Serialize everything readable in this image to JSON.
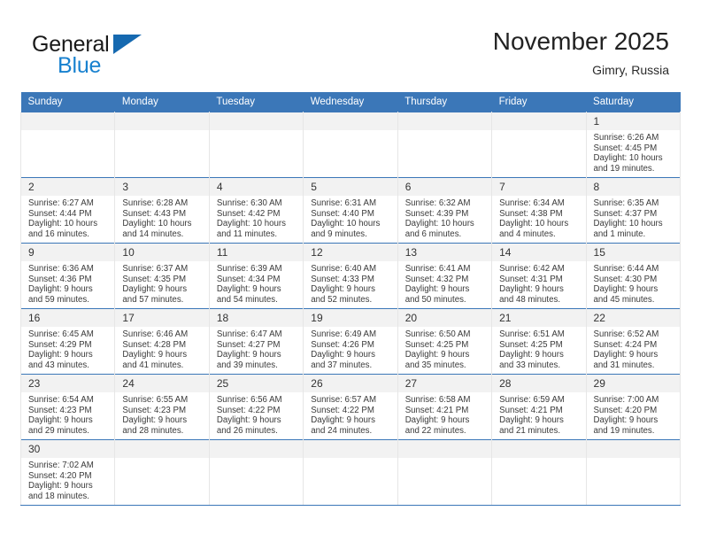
{
  "brand": {
    "name_part1": "General",
    "name_part2": "Blue",
    "accent_color": "#1881cf",
    "triangle_color": "#1569b0"
  },
  "header": {
    "title": "November 2025",
    "location": "Gimry, Russia"
  },
  "calendar": {
    "header_bg": "#3b77b8",
    "weekdays": [
      "Sunday",
      "Monday",
      "Tuesday",
      "Wednesday",
      "Thursday",
      "Friday",
      "Saturday"
    ],
    "weeks": [
      [
        {
          "day": "",
          "sunrise": "",
          "sunset": "",
          "daylight1": "",
          "daylight2": ""
        },
        {
          "day": "",
          "sunrise": "",
          "sunset": "",
          "daylight1": "",
          "daylight2": ""
        },
        {
          "day": "",
          "sunrise": "",
          "sunset": "",
          "daylight1": "",
          "daylight2": ""
        },
        {
          "day": "",
          "sunrise": "",
          "sunset": "",
          "daylight1": "",
          "daylight2": ""
        },
        {
          "day": "",
          "sunrise": "",
          "sunset": "",
          "daylight1": "",
          "daylight2": ""
        },
        {
          "day": "",
          "sunrise": "",
          "sunset": "",
          "daylight1": "",
          "daylight2": ""
        },
        {
          "day": "1",
          "sunrise": "Sunrise: 6:26 AM",
          "sunset": "Sunset: 4:45 PM",
          "daylight1": "Daylight: 10 hours",
          "daylight2": "and 19 minutes."
        }
      ],
      [
        {
          "day": "2",
          "sunrise": "Sunrise: 6:27 AM",
          "sunset": "Sunset: 4:44 PM",
          "daylight1": "Daylight: 10 hours",
          "daylight2": "and 16 minutes."
        },
        {
          "day": "3",
          "sunrise": "Sunrise: 6:28 AM",
          "sunset": "Sunset: 4:43 PM",
          "daylight1": "Daylight: 10 hours",
          "daylight2": "and 14 minutes."
        },
        {
          "day": "4",
          "sunrise": "Sunrise: 6:30 AM",
          "sunset": "Sunset: 4:42 PM",
          "daylight1": "Daylight: 10 hours",
          "daylight2": "and 11 minutes."
        },
        {
          "day": "5",
          "sunrise": "Sunrise: 6:31 AM",
          "sunset": "Sunset: 4:40 PM",
          "daylight1": "Daylight: 10 hours",
          "daylight2": "and 9 minutes."
        },
        {
          "day": "6",
          "sunrise": "Sunrise: 6:32 AM",
          "sunset": "Sunset: 4:39 PM",
          "daylight1": "Daylight: 10 hours",
          "daylight2": "and 6 minutes."
        },
        {
          "day": "7",
          "sunrise": "Sunrise: 6:34 AM",
          "sunset": "Sunset: 4:38 PM",
          "daylight1": "Daylight: 10 hours",
          "daylight2": "and 4 minutes."
        },
        {
          "day": "8",
          "sunrise": "Sunrise: 6:35 AM",
          "sunset": "Sunset: 4:37 PM",
          "daylight1": "Daylight: 10 hours",
          "daylight2": "and 1 minute."
        }
      ],
      [
        {
          "day": "9",
          "sunrise": "Sunrise: 6:36 AM",
          "sunset": "Sunset: 4:36 PM",
          "daylight1": "Daylight: 9 hours",
          "daylight2": "and 59 minutes."
        },
        {
          "day": "10",
          "sunrise": "Sunrise: 6:37 AM",
          "sunset": "Sunset: 4:35 PM",
          "daylight1": "Daylight: 9 hours",
          "daylight2": "and 57 minutes."
        },
        {
          "day": "11",
          "sunrise": "Sunrise: 6:39 AM",
          "sunset": "Sunset: 4:34 PM",
          "daylight1": "Daylight: 9 hours",
          "daylight2": "and 54 minutes."
        },
        {
          "day": "12",
          "sunrise": "Sunrise: 6:40 AM",
          "sunset": "Sunset: 4:33 PM",
          "daylight1": "Daylight: 9 hours",
          "daylight2": "and 52 minutes."
        },
        {
          "day": "13",
          "sunrise": "Sunrise: 6:41 AM",
          "sunset": "Sunset: 4:32 PM",
          "daylight1": "Daylight: 9 hours",
          "daylight2": "and 50 minutes."
        },
        {
          "day": "14",
          "sunrise": "Sunrise: 6:42 AM",
          "sunset": "Sunset: 4:31 PM",
          "daylight1": "Daylight: 9 hours",
          "daylight2": "and 48 minutes."
        },
        {
          "day": "15",
          "sunrise": "Sunrise: 6:44 AM",
          "sunset": "Sunset: 4:30 PM",
          "daylight1": "Daylight: 9 hours",
          "daylight2": "and 45 minutes."
        }
      ],
      [
        {
          "day": "16",
          "sunrise": "Sunrise: 6:45 AM",
          "sunset": "Sunset: 4:29 PM",
          "daylight1": "Daylight: 9 hours",
          "daylight2": "and 43 minutes."
        },
        {
          "day": "17",
          "sunrise": "Sunrise: 6:46 AM",
          "sunset": "Sunset: 4:28 PM",
          "daylight1": "Daylight: 9 hours",
          "daylight2": "and 41 minutes."
        },
        {
          "day": "18",
          "sunrise": "Sunrise: 6:47 AM",
          "sunset": "Sunset: 4:27 PM",
          "daylight1": "Daylight: 9 hours",
          "daylight2": "and 39 minutes."
        },
        {
          "day": "19",
          "sunrise": "Sunrise: 6:49 AM",
          "sunset": "Sunset: 4:26 PM",
          "daylight1": "Daylight: 9 hours",
          "daylight2": "and 37 minutes."
        },
        {
          "day": "20",
          "sunrise": "Sunrise: 6:50 AM",
          "sunset": "Sunset: 4:25 PM",
          "daylight1": "Daylight: 9 hours",
          "daylight2": "and 35 minutes."
        },
        {
          "day": "21",
          "sunrise": "Sunrise: 6:51 AM",
          "sunset": "Sunset: 4:25 PM",
          "daylight1": "Daylight: 9 hours",
          "daylight2": "and 33 minutes."
        },
        {
          "day": "22",
          "sunrise": "Sunrise: 6:52 AM",
          "sunset": "Sunset: 4:24 PM",
          "daylight1": "Daylight: 9 hours",
          "daylight2": "and 31 minutes."
        }
      ],
      [
        {
          "day": "23",
          "sunrise": "Sunrise: 6:54 AM",
          "sunset": "Sunset: 4:23 PM",
          "daylight1": "Daylight: 9 hours",
          "daylight2": "and 29 minutes."
        },
        {
          "day": "24",
          "sunrise": "Sunrise: 6:55 AM",
          "sunset": "Sunset: 4:23 PM",
          "daylight1": "Daylight: 9 hours",
          "daylight2": "and 28 minutes."
        },
        {
          "day": "25",
          "sunrise": "Sunrise: 6:56 AM",
          "sunset": "Sunset: 4:22 PM",
          "daylight1": "Daylight: 9 hours",
          "daylight2": "and 26 minutes."
        },
        {
          "day": "26",
          "sunrise": "Sunrise: 6:57 AM",
          "sunset": "Sunset: 4:22 PM",
          "daylight1": "Daylight: 9 hours",
          "daylight2": "and 24 minutes."
        },
        {
          "day": "27",
          "sunrise": "Sunrise: 6:58 AM",
          "sunset": "Sunset: 4:21 PM",
          "daylight1": "Daylight: 9 hours",
          "daylight2": "and 22 minutes."
        },
        {
          "day": "28",
          "sunrise": "Sunrise: 6:59 AM",
          "sunset": "Sunset: 4:21 PM",
          "daylight1": "Daylight: 9 hours",
          "daylight2": "and 21 minutes."
        },
        {
          "day": "29",
          "sunrise": "Sunrise: 7:00 AM",
          "sunset": "Sunset: 4:20 PM",
          "daylight1": "Daylight: 9 hours",
          "daylight2": "and 19 minutes."
        }
      ],
      [
        {
          "day": "30",
          "sunrise": "Sunrise: 7:02 AM",
          "sunset": "Sunset: 4:20 PM",
          "daylight1": "Daylight: 9 hours",
          "daylight2": "and 18 minutes."
        },
        {
          "day": "",
          "sunrise": "",
          "sunset": "",
          "daylight1": "",
          "daylight2": ""
        },
        {
          "day": "",
          "sunrise": "",
          "sunset": "",
          "daylight1": "",
          "daylight2": ""
        },
        {
          "day": "",
          "sunrise": "",
          "sunset": "",
          "daylight1": "",
          "daylight2": ""
        },
        {
          "day": "",
          "sunrise": "",
          "sunset": "",
          "daylight1": "",
          "daylight2": ""
        },
        {
          "day": "",
          "sunrise": "",
          "sunset": "",
          "daylight1": "",
          "daylight2": ""
        },
        {
          "day": "",
          "sunrise": "",
          "sunset": "",
          "daylight1": "",
          "daylight2": ""
        }
      ]
    ]
  }
}
